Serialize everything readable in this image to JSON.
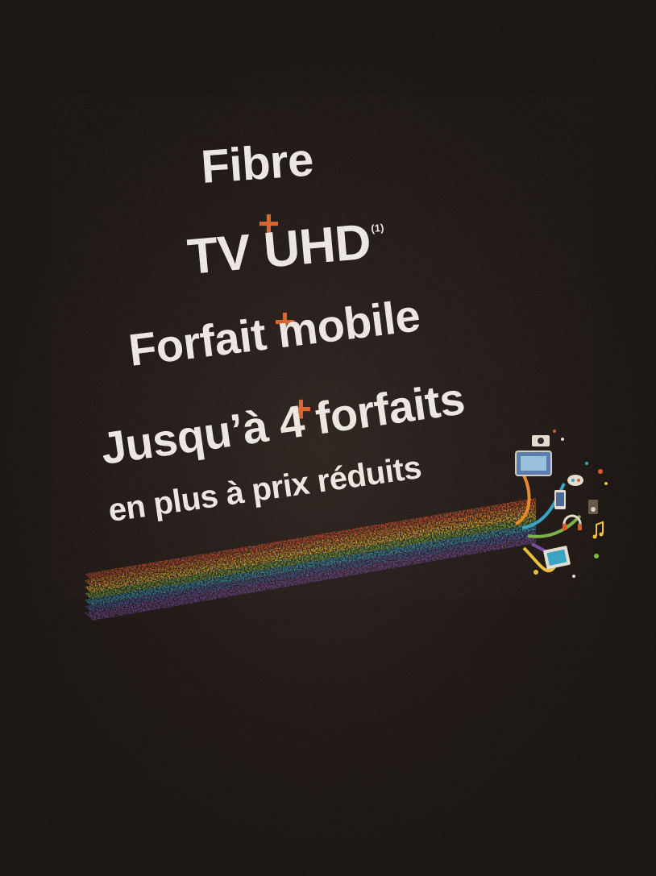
{
  "headline": {
    "line1": "Fibre",
    "plus": "+",
    "line2": "TV UHD",
    "line2_sup": "(1)",
    "line3": "Forfait mobile",
    "line4": "Jusqu’à 4 forfaits",
    "line5": "en plus à prix réduits"
  },
  "colors": {
    "background": "#1a1310",
    "text": "#f1ede6",
    "accent_plus": "#e0662e",
    "rainbow": [
      "#e25a2c",
      "#f08c2e",
      "#f3c23a",
      "#7fb84a",
      "#3aa6c9",
      "#5166b8",
      "#7a4fa3"
    ]
  },
  "illustration": {
    "icons": [
      "tv-icon",
      "phone-icon",
      "tablet-icon",
      "controller-icon",
      "headphones-icon",
      "camera-icon",
      "speaker-icon",
      "music-note-icon"
    ]
  }
}
